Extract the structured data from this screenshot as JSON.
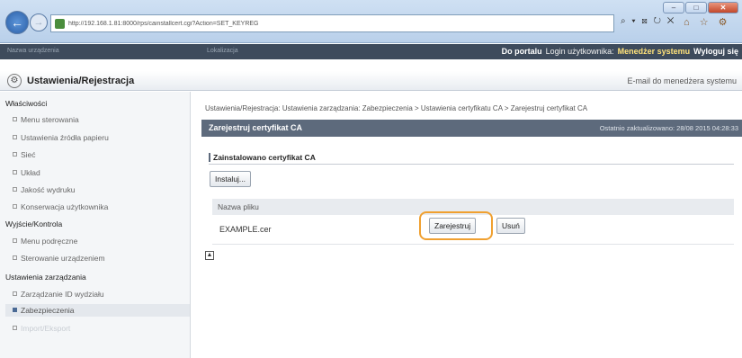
{
  "browser": {
    "url": "http://192.168.1.81:8000/rps/cainstallcert.cgi?Action=SET_KEYREG",
    "address_right": "⌕ ▾ ⊠ ↻ ✕",
    "tools": "⌂ ☆ ⚙",
    "window_buttons": [
      "–",
      "□",
      "✕"
    ]
  },
  "header": {
    "left_text": "Nazwa urządzenia",
    "mid_text": "Lokalizacja",
    "portal_link": "Do portalu",
    "login_label": "Login użytkownika:",
    "login_user": "Menedżer systemu",
    "logout_link": "Wyloguj się"
  },
  "section": {
    "title": "Ustawienia/Rejestracja",
    "email_link": "E-mail do menedżera systemu"
  },
  "sidebar": {
    "groups": [
      {
        "title": "Właściwości",
        "items": [
          "Menu sterowania",
          "Ustawienia źródła papieru",
          "Sieć",
          "Układ",
          "Jakość wydruku",
          "Konserwacja użytkownika"
        ]
      },
      {
        "title": "Wyjście/Kontrola",
        "items": [
          "Menu podręczne",
          "Sterowanie urządzeniem"
        ]
      },
      {
        "title": "Ustawienia zarządzania",
        "items": [
          "Zarządzanie ID wydziału",
          "Zabezpieczenia",
          "Import/Eksport"
        ]
      }
    ]
  },
  "main": {
    "breadcrumb": "Ustawienia/Rejestracja: Ustawienia zarządzania: Zabezpieczenia > Ustawienia certyfikatu CA > Zarejestruj certyfikat CA",
    "page_title": "Zarejestruj certyfikat CA",
    "last_updated": "Ostatnio zaktualizowano: 28/08 2015 04:28:33",
    "subheading": "Zainstalowano certyfikat CA",
    "install_button": "Instaluj...",
    "column_header": "Nazwa pliku",
    "file_name": "EXAMPLE.cer",
    "register_button": "Zarejestruj",
    "delete_button": "Usuń",
    "top_icon": "▲"
  }
}
